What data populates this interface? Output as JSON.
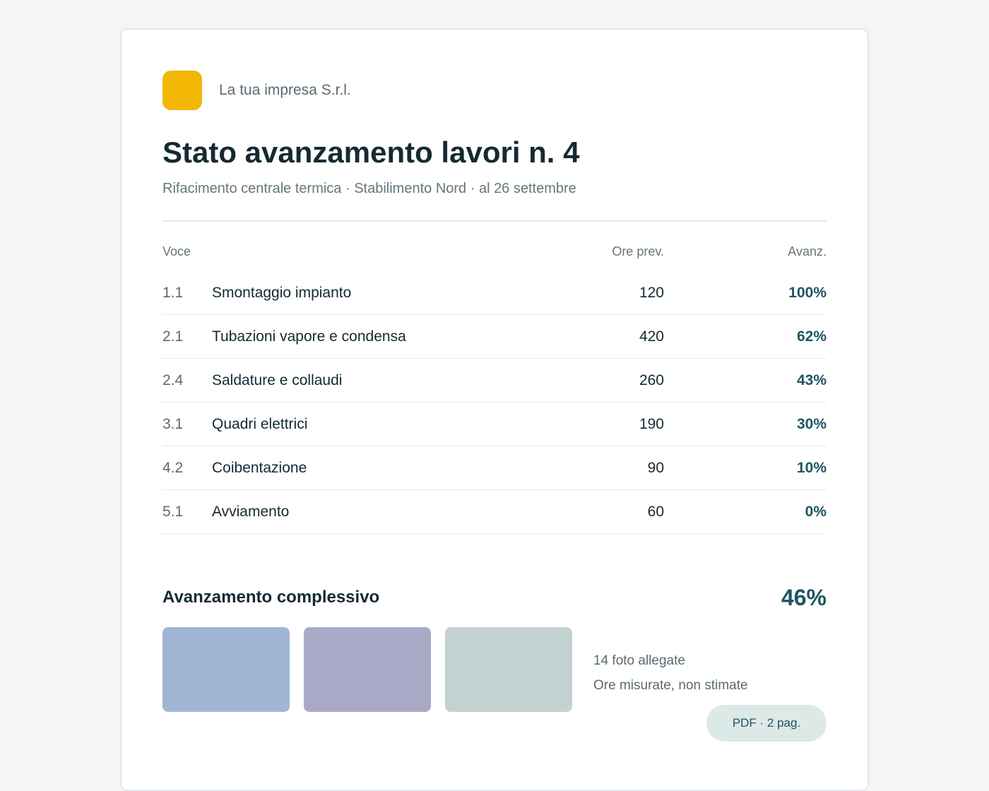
{
  "company": {
    "name": "La tua impresa S.r.l.",
    "logo_color": "#f2b705"
  },
  "document": {
    "title": "Stato avanzamento lavori n. 4",
    "subtitle": "Rifacimento centrale termica · Stabilimento Nord · al 26 settembre"
  },
  "table": {
    "headers": {
      "voce": "Voce",
      "ore": "Ore prev.",
      "avanz": "Avanz."
    },
    "rows": [
      {
        "code": "1.1",
        "desc": "Smontaggio impianto",
        "ore": "120",
        "avanz": "100%"
      },
      {
        "code": "2.1",
        "desc": "Tubazioni vapore e condensa",
        "ore": "420",
        "avanz": "62%"
      },
      {
        "code": "2.4",
        "desc": "Saldature e collaudi",
        "ore": "260",
        "avanz": "43%"
      },
      {
        "code": "3.1",
        "desc": "Quadri elettrici",
        "ore": "190",
        "avanz": "30%"
      },
      {
        "code": "4.2",
        "desc": "Coibentazione",
        "ore": "90",
        "avanz": "10%"
      },
      {
        "code": "5.1",
        "desc": "Avviamento",
        "ore": "60",
        "avanz": "0%"
      }
    ]
  },
  "summary": {
    "label": "Avanzamento complessivo",
    "value": "46%"
  },
  "attachments": {
    "photo_colors": [
      "#a0b6d4",
      "#aaaac8",
      "#c3d2d1"
    ],
    "photos_count": "14 foto allegate",
    "note": "Ore misurate, non stimate",
    "pdf_label": "PDF · 2 pag."
  },
  "colors": {
    "accent": "#1d5661",
    "pdf_badge_bg": "#dce9e7"
  }
}
